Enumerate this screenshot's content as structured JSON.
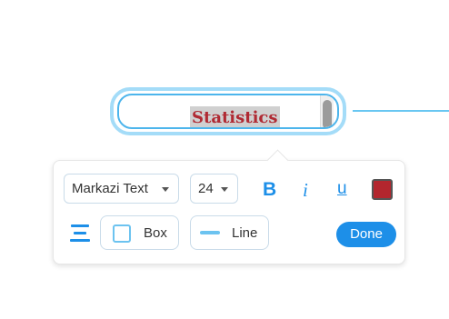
{
  "node": {
    "text": "Statistics"
  },
  "toolbar": {
    "font_family": "Markazi Text",
    "font_size": "24",
    "bold_label": "B",
    "italic_label": "i",
    "underline_label": "u",
    "text_color": "#b3262e",
    "box_label": "Box",
    "line_label": "Line",
    "done_label": "Done"
  },
  "colors": {
    "accent": "#1d8fe8",
    "node_border": "#4db5ec",
    "text": "#b02a33"
  }
}
